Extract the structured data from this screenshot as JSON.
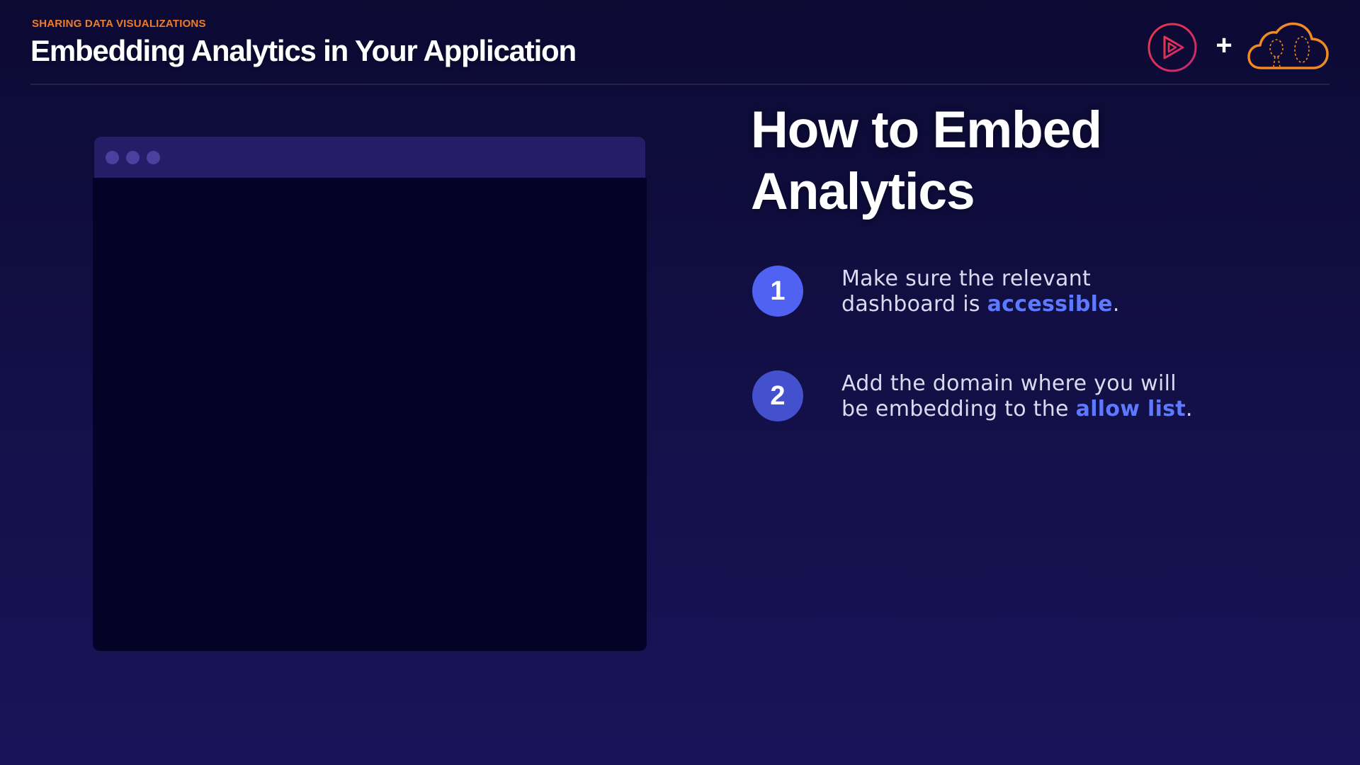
{
  "header": {
    "kicker": "SHARING DATA VISUALIZATIONS",
    "title": "Embedding Analytics in Your Application",
    "plus": "+"
  },
  "logos": {
    "left_icon": "play-circle-icon",
    "right_icon": "cloud-icon",
    "colors": {
      "play": "#e0304f",
      "cloud": "#f08a24"
    }
  },
  "main": {
    "title_line1": "How to Embed",
    "title_line2": "Analytics",
    "steps": [
      {
        "number": "1",
        "line1": "Make sure the relevant",
        "line2_prefix": "dashboard is ",
        "highlight": "accessible",
        "suffix": "."
      },
      {
        "number": "2",
        "line1": "Add the domain where you will",
        "line2_prefix": "be embedding to the ",
        "highlight": "allow list",
        "suffix": "."
      }
    ]
  },
  "colors": {
    "accent_orange": "#ef7b2b",
    "highlight_blue": "#5c79ff",
    "step_1_circle": "#4f62f2",
    "step_2_circle": "#4351cf"
  }
}
